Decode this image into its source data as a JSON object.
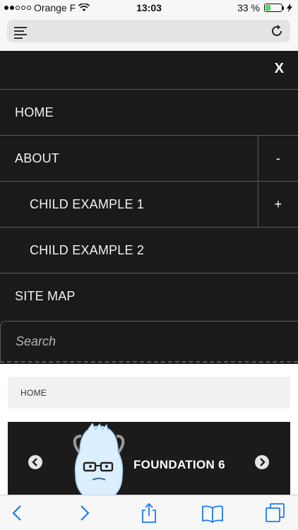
{
  "status_bar": {
    "carrier": "Orange F",
    "time": "13:03",
    "battery": "33 %",
    "battery_level": 0.33
  },
  "address_bar": {
    "reader_icon": "reader-lines-icon",
    "reload_icon": "reload-icon"
  },
  "menu": {
    "close_label": "X",
    "items": [
      {
        "label": "HOME"
      },
      {
        "label": "ABOUT",
        "toggle": "-"
      },
      {
        "label": "CHILD EXAMPLE 1",
        "toggle": "+"
      },
      {
        "label": "CHILD EXAMPLE 2"
      },
      {
        "label": "SITE MAP"
      }
    ],
    "search_placeholder": "Search"
  },
  "breadcrumb": {
    "label": "HOME"
  },
  "slider": {
    "title": "FOUNDATION 6",
    "prev_icon": "chevron-left-icon",
    "next_icon": "chevron-right-icon"
  },
  "toolbar": {
    "icons": [
      "back-icon",
      "forward-icon",
      "share-icon",
      "bookmarks-icon",
      "tabs-icon"
    ],
    "accent": "#1a7cf4"
  }
}
